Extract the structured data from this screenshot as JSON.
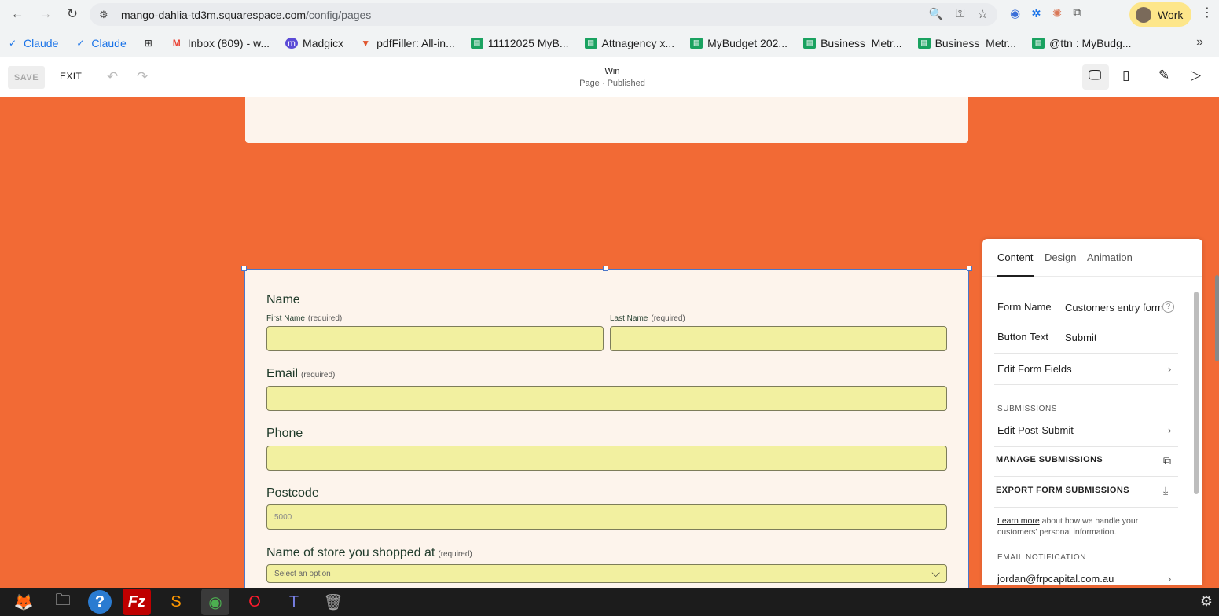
{
  "browser": {
    "url_host": "mango-dahlia-td3m.squarespace.com",
    "url_path": "/config/pages",
    "profile_label": "Work",
    "bookmarks": [
      {
        "label": "Claude",
        "icon": "claude-check-icon"
      },
      {
        "label": "Claude",
        "icon": "claude-check-icon"
      },
      {
        "label": "",
        "icon": "apps-grid-icon"
      },
      {
        "label": "Inbox (809) - w...",
        "icon": "gmail-icon"
      },
      {
        "label": "Madgicx",
        "icon": "madgicx-icon"
      },
      {
        "label": "pdfFiller: All-in...",
        "icon": "pdffiller-icon"
      },
      {
        "label": "11112025 MyB...",
        "icon": "sheets-icon"
      },
      {
        "label": "Attnagency x...",
        "icon": "sheets-icon"
      },
      {
        "label": "MyBudget 202...",
        "icon": "sheets-icon"
      },
      {
        "label": "Business_Metr...",
        "icon": "sheets-icon"
      },
      {
        "label": "Business_Metr...",
        "icon": "sheets-icon"
      },
      {
        "label": "@ttn : MyBudg...",
        "icon": "sheets-icon"
      }
    ]
  },
  "editor": {
    "save_label": "SAVE",
    "exit_label": "EXIT",
    "page_title": "Win",
    "page_status": "Page · Published"
  },
  "form": {
    "name_label": "Name",
    "first_name_label": "First Name",
    "last_name_label": "Last Name",
    "required_text": "(required)",
    "email_label": "Email",
    "phone_label": "Phone",
    "postcode_label": "Postcode",
    "postcode_placeholder": "5000",
    "store_label": "Name of store you shopped at",
    "store_placeholder": "Select an option"
  },
  "panel": {
    "tabs": [
      "Content",
      "Design",
      "Animation"
    ],
    "active_tab": "Content",
    "form_name_label": "Form Name",
    "form_name_value": "Customers entry form",
    "button_text_label": "Button Text",
    "button_text_value": "Submit",
    "edit_fields_label": "Edit Form Fields",
    "submissions_heading": "SUBMISSIONS",
    "edit_post_submit_label": "Edit Post-Submit",
    "manage_submissions_label": "MANAGE SUBMISSIONS",
    "export_submissions_label": "EXPORT FORM SUBMISSIONS",
    "learn_more_label": "Learn more",
    "learn_more_rest": " about how we handle your customers' personal information.",
    "email_notification_heading": "EMAIL NOTIFICATION",
    "email_value": "jordan@frpcapital.com.au"
  },
  "colors": {
    "canvas_bg": "#f26a35",
    "card_bg": "#fdf4ec",
    "field_bg": "#f2f0a0",
    "selection_blue": "#4a76c9"
  }
}
